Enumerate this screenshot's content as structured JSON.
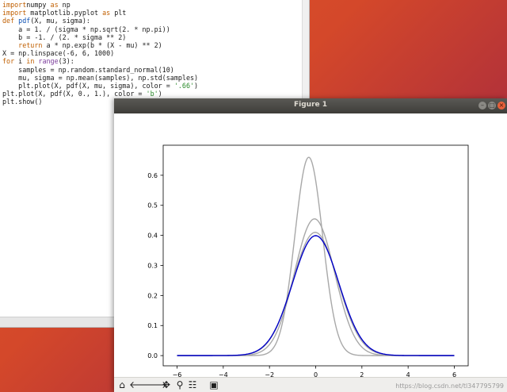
{
  "editor": {
    "lines": [
      [
        [
          "kw",
          "import"
        ],
        [
          "",
          "numpy "
        ],
        [
          "kw",
          "as"
        ],
        [
          "",
          " np"
        ]
      ],
      [
        [
          "kw",
          "import"
        ],
        [
          "",
          " matplotlib.pyplot "
        ],
        [
          "kw",
          "as"
        ],
        [
          "",
          " plt"
        ]
      ],
      [
        [
          "kw",
          "def"
        ],
        [
          "fn",
          " pdf"
        ],
        [
          "",
          "(X, mu, sigma):"
        ]
      ],
      [
        [
          "",
          "    a = 1. / (sigma * np.sqrt(2. * np.pi))"
        ]
      ],
      [
        [
          "",
          "    b = -1. / (2. * sigma ** 2)"
        ]
      ],
      [
        [
          "",
          "    "
        ],
        [
          "kw",
          "return"
        ],
        [
          "",
          " a * np.exp(b * (X - mu) ** 2)"
        ]
      ],
      [
        [
          "",
          "X = np.linspace(-6, 6, 1000)"
        ]
      ],
      [
        [
          "kw",
          "for"
        ],
        [
          "",
          " i "
        ],
        [
          "kw",
          "in"
        ],
        [
          "",
          " "
        ],
        [
          "bi",
          "range"
        ],
        [
          "",
          "(3):"
        ]
      ],
      [
        [
          "",
          "    samples = np.random.standard_normal(10)"
        ]
      ],
      [
        [
          "",
          "    mu, sigma = np.mean(samples), np.std(samples)"
        ]
      ],
      [
        [
          "",
          "    plt.plot(X, pdf(X, mu, sigma), color = "
        ],
        [
          "st",
          "'.66'"
        ],
        [
          "",
          ")"
        ]
      ],
      [
        [
          "",
          "plt.plot(X, pdf(X, 0., 1.), color = "
        ],
        [
          "st",
          "'b'"
        ],
        [
          "",
          ")"
        ]
      ],
      [
        [
          "",
          "plt.show()"
        ]
      ]
    ]
  },
  "figure": {
    "title": "Figure 1",
    "watermark": "https://blog.csdn.net/tl347795799",
    "toolbar": [
      "home-icon",
      "back-icon",
      "forward-icon",
      "pan-icon",
      "zoom-icon",
      "configure-icon",
      "save-icon"
    ]
  },
  "chart_data": {
    "type": "line",
    "xlim": [
      -6.6,
      6.6
    ],
    "ylim": [
      -0.034,
      0.7
    ],
    "xticks": [
      -6,
      -4,
      -2,
      0,
      2,
      4,
      6
    ],
    "yticks": [
      0.0,
      0.1,
      0.2,
      0.3,
      0.4,
      0.5,
      0.6
    ],
    "ytick_labels": [
      "0.0",
      "0.1",
      "0.2",
      "0.3",
      "0.4",
      "0.5",
      "0.6"
    ],
    "xtick_labels": [
      "−6",
      "−4",
      "−2",
      "0",
      "2",
      "4",
      "6"
    ],
    "series": [
      {
        "color": "#a8a8a8",
        "mu": -0.3,
        "sigma": 0.6,
        "peak": 0.66
      },
      {
        "color": "#a8a8a8",
        "mu": -0.05,
        "sigma": 0.87,
        "peak": 0.455
      },
      {
        "color": "#a8a8a8",
        "mu": -0.02,
        "sigma": 0.975,
        "peak": 0.41
      },
      {
        "color": "#0000c8",
        "mu": 0.0,
        "sigma": 1.0,
        "peak": 0.399
      }
    ]
  }
}
